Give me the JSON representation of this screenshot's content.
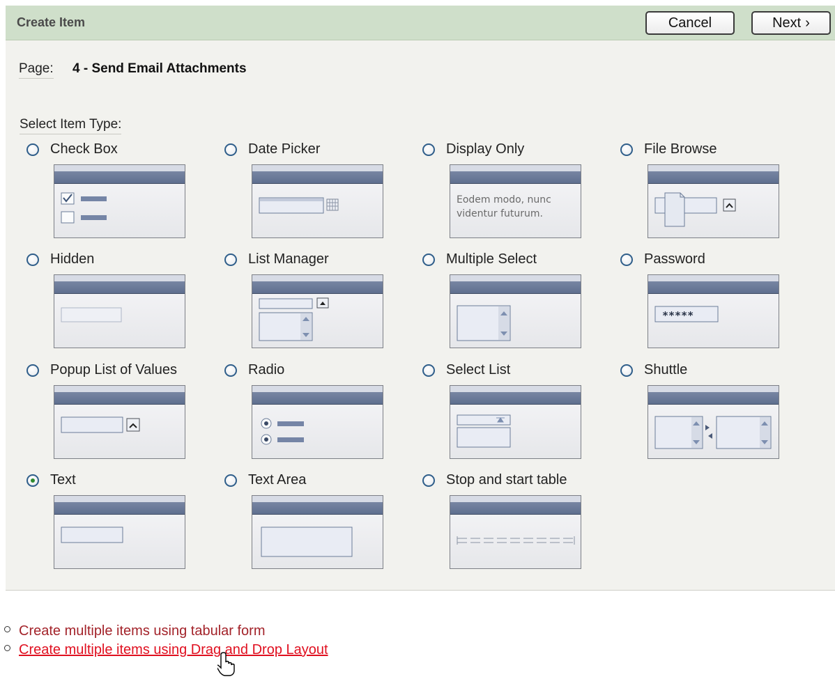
{
  "header": {
    "title": "Create Item",
    "cancel_label": "Cancel",
    "next_label": "Next",
    "next_chevron": "›"
  },
  "page": {
    "label": "Page:",
    "value": "4 - Send Email Attachments"
  },
  "item_type": {
    "label": "Select Item Type:",
    "selected": "Text",
    "options": [
      {
        "label": "Check Box"
      },
      {
        "label": "Date Picker"
      },
      {
        "label": "Display Only",
        "preview_text": [
          "Eodem modo, nunc",
          "videntur futurum."
        ]
      },
      {
        "label": "File Browse"
      },
      {
        "label": "Hidden"
      },
      {
        "label": "List Manager"
      },
      {
        "label": "Multiple Select"
      },
      {
        "label": "Password",
        "preview_text": "*****"
      },
      {
        "label": "Popup List of Values"
      },
      {
        "label": "Radio"
      },
      {
        "label": "Select List"
      },
      {
        "label": "Shuttle"
      },
      {
        "label": "Text"
      },
      {
        "label": "Text Area"
      },
      {
        "label": "Stop and start table"
      }
    ]
  },
  "links": [
    {
      "label": "Create multiple items using tabular form",
      "state": "normal"
    },
    {
      "label": "Create multiple items using Drag and Drop Layout",
      "state": "hover"
    }
  ],
  "colors": {
    "header_bg": "#cfdfca",
    "link": "#a3232a",
    "link_hover": "#e01020",
    "radio_checked": "#2e8a2e"
  }
}
